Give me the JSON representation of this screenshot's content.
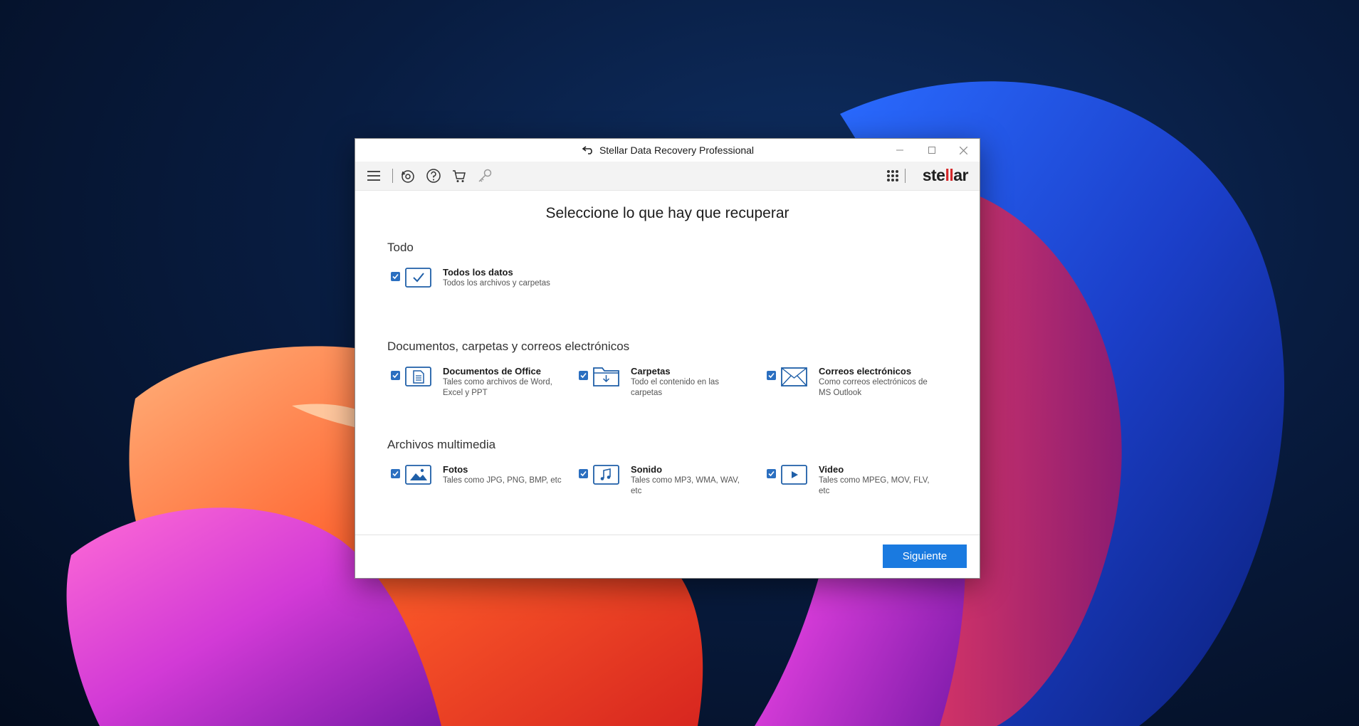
{
  "window": {
    "title": "Stellar Data Recovery Professional"
  },
  "toolbar": {
    "icons": [
      "menu-icon",
      "recover-icon",
      "help-icon",
      "cart-icon",
      "key-icon",
      "apps-grid-icon"
    ],
    "brand": {
      "before": "ste",
      "highlight": "ll",
      "after": "ar"
    }
  },
  "main": {
    "heading": "Seleccione lo que hay que recuperar",
    "sections": [
      {
        "title": "Todo",
        "options": [
          {
            "label": "Todos los datos",
            "desc": "Todos los archivos y carpetas",
            "icon": "checkmark-box-icon",
            "checked": true
          }
        ]
      },
      {
        "title": "Documentos, carpetas y correos electrónicos",
        "options": [
          {
            "label": "Documentos de Office",
            "desc": "Tales como archivos de Word, Excel y PPT",
            "icon": "document-icon",
            "checked": true
          },
          {
            "label": "Carpetas",
            "desc": "Todo el contenido en las carpetas",
            "icon": "folder-icon",
            "checked": true
          },
          {
            "label": "Correos electrónicos",
            "desc": "Como correos electrónicos de MS Outlook",
            "icon": "envelope-icon",
            "checked": true
          }
        ]
      },
      {
        "title": "Archivos multimedia",
        "options": [
          {
            "label": "Fotos",
            "desc": "Tales como JPG, PNG, BMP, etc",
            "icon": "photo-icon",
            "checked": true
          },
          {
            "label": "Sonido",
            "desc": "Tales como MP3, WMA, WAV, etc",
            "icon": "music-icon",
            "checked": true
          },
          {
            "label": "Video",
            "desc": "Tales como MPEG, MOV, FLV, etc",
            "icon": "video-icon",
            "checked": true
          }
        ]
      }
    ]
  },
  "footer": {
    "next_label": "Siguiente"
  },
  "colors": {
    "accent": "#1a7ae0",
    "icon_blue": "#1f5fa8",
    "brand_red": "#d4282a"
  }
}
